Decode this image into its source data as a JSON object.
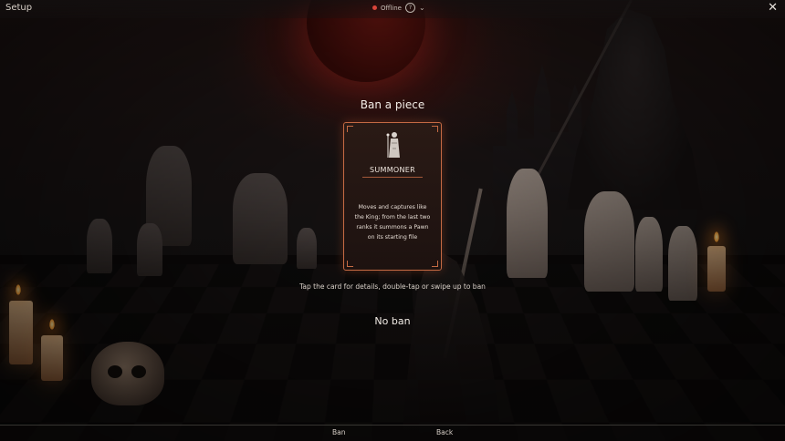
{
  "window": {
    "title": "Setup",
    "close_icon": "close-icon"
  },
  "connection": {
    "status": "Offline",
    "status_color": "#d9453a",
    "help_glyph": "?",
    "chevron": "⌄"
  },
  "dialog": {
    "heading": "Ban a piece",
    "card": {
      "name": "SUMMONER",
      "icon": "summoner-figure-icon",
      "description": "Moves and captures like the King; from the last two ranks it summons a Pawn on its starting file",
      "border_color": "#c56a43"
    },
    "hint": "Tap the card for details, double-tap or swipe up to ban",
    "no_ban_label": "No ban"
  },
  "footer": {
    "ban_label": "Ban",
    "back_label": "Back"
  }
}
